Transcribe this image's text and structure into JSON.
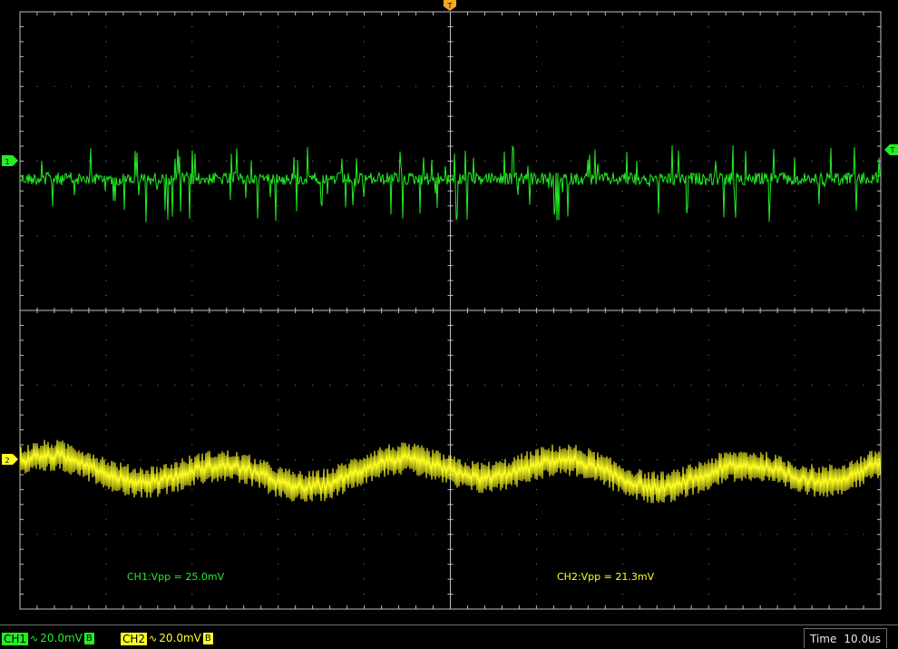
{
  "colors": {
    "ch1": "#22ee22",
    "ch2": "#ffff22",
    "grid": "#bfbfbf",
    "dot": "#8a8a8a",
    "trigger": "#f5a623",
    "background": "#000000"
  },
  "markers": {
    "trigger_top": "T",
    "trigger_right": "T",
    "ch1_ground": "1",
    "ch2_ground": "2"
  },
  "measurements": {
    "ch1": "CH1:Vpp = 25.0mV",
    "ch2": "CH2:Vpp = 21.3mV"
  },
  "status": {
    "ch1": {
      "tag": "CH1",
      "coupling_icon": "ac-coupling-icon",
      "coupling": "∿",
      "scale": "20.0mV",
      "bw": "B"
    },
    "ch2": {
      "tag": "CH2",
      "coupling_icon": "ac-coupling-icon",
      "coupling": "∿",
      "scale": "20.0mV",
      "bw": "B"
    },
    "time_label": "Time",
    "time_value": "10.0us"
  }
}
